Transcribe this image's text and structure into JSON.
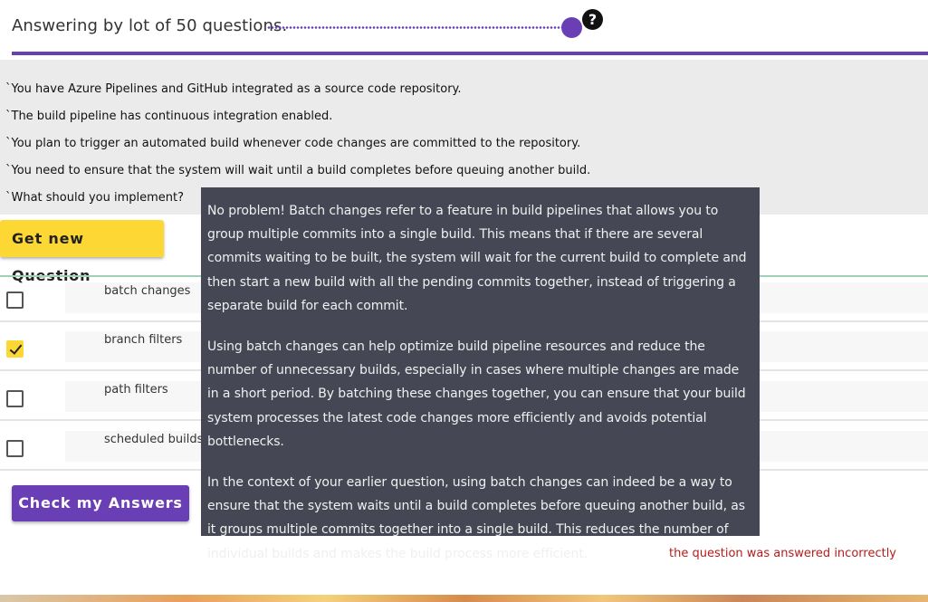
{
  "header": {
    "title": "Answering by lot of 50 questions.",
    "help_symbol": "?"
  },
  "question": {
    "lines": [
      "`You have Azure Pipelines and GitHub integrated as a source code repository.",
      "`The build pipeline has continuous integration enabled.",
      "`You plan to trigger an automated build whenever code changes are committed to the repository.",
      "`You need to ensure that the system will wait until a build completes before queuing another build.",
      "`What should you implement?"
    ]
  },
  "buttons": {
    "new_question": "Get new Question",
    "check_answers": "Check my Answers"
  },
  "options": [
    {
      "label": "batch changes",
      "checked": false
    },
    {
      "label": "branch filters",
      "checked": true
    },
    {
      "label": "path filters",
      "checked": false
    },
    {
      "label": "scheduled builds",
      "checked": false
    }
  ],
  "tooltip": {
    "paragraphs": [
      "No problem! Batch changes refer to a feature in build pipelines that allows you to group multiple commits into a single build. This means that if there are several commits waiting to be built, the system will wait for the current build to complete and then start a new build with all the pending commits together, instead of triggering a separate build for each commit.",
      "Using batch changes can help optimize build pipeline resources and reduce the number of unnecessary builds, especially in cases where multiple changes are made in a short period. By batching these changes together, you can ensure that your build system processes the latest code changes more efficiently and avoids potential bottlenecks.",
      "In the context of your earlier question, using batch changes can indeed be a way to ensure that the system waits until a build completes before queuing another build, as it groups multiple commits together into a single build. This reduces the number of individual builds and makes the build process more efficient."
    ]
  },
  "status": {
    "message": "the question was answered incorrectly"
  },
  "colors": {
    "accent": "#6a3fb5",
    "button_yellow": "#fdd835",
    "tooltip_bg": "#464754",
    "error_text": "#b71c1c"
  }
}
